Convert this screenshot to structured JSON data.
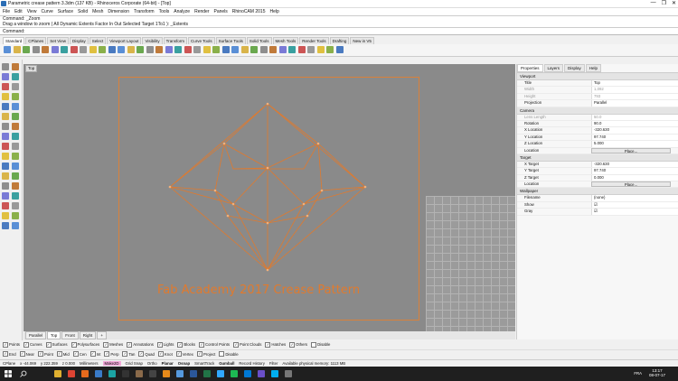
{
  "window": {
    "title": "Parametric crease pattern 3.3dm (137 KB) - Rhinoceros Corporate (64-bit) - [Top]",
    "minimize": "—",
    "maximize": "❐",
    "close": "✕"
  },
  "menu": [
    "File",
    "Edit",
    "View",
    "Curve",
    "Surface",
    "Solid",
    "Mesh",
    "Dimension",
    "Transform",
    "Tools",
    "Analyze",
    "Render",
    "Panels",
    "RhinoCAM 2015",
    "Help"
  ],
  "command_history": [
    "Command: _Zoom",
    "Drag a window to zoom ( All  Dynamic  Extents  Factor  In  Out  Selected  Target  1To1 ): _Extents"
  ],
  "command_prompt": "Command:",
  "toolbar_tabs": [
    "Standard",
    "CPlanes",
    "Set View",
    "Display",
    "Select",
    "Viewport Layout",
    "Visibility",
    "Transform",
    "Curve Tools",
    "Surface Tools",
    "Solid Tools",
    "Mesh Tools",
    "Render Tools",
    "Drafting",
    "New in V5"
  ],
  "viewport": {
    "label": "Top",
    "caption": "Fab Academy 2017 Crease Pattern",
    "tabs": [
      "Parallel",
      "Top",
      "Front",
      "Right"
    ],
    "add_tab": "+"
  },
  "panel": {
    "tabs": [
      "Properties",
      "Layers",
      "Display",
      "Help"
    ],
    "sections": [
      {
        "title": "Viewport",
        "rows": [
          {
            "k": "Title",
            "v": "Top",
            "dim": false
          },
          {
            "k": "Width",
            "v": "1,092",
            "dim": true
          },
          {
            "k": "Height",
            "v": "793",
            "dim": true
          },
          {
            "k": "Projection",
            "v": "Parallel",
            "dim": false
          }
        ]
      },
      {
        "title": "Camera",
        "rows": [
          {
            "k": "Lens Length",
            "v": "50.0",
            "dim": true
          },
          {
            "k": "Rotation",
            "v": "90.0",
            "dim": false
          },
          {
            "k": "X Location",
            "v": "-320.630",
            "dim": false
          },
          {
            "k": "Y Location",
            "v": "97.740",
            "dim": false
          },
          {
            "k": "Z Location",
            "v": "5.000",
            "dim": false
          },
          {
            "k": "Location",
            "v": "Place...",
            "button": true
          }
        ]
      },
      {
        "title": "Target",
        "rows": [
          {
            "k": "X Target",
            "v": "-320.630",
            "dim": false
          },
          {
            "k": "Y Target",
            "v": "97.740",
            "dim": false
          },
          {
            "k": "Z Target",
            "v": "0.000",
            "dim": false
          },
          {
            "k": "Location",
            "v": "Place...",
            "button": true
          }
        ]
      },
      {
        "title": "Wallpaper",
        "rows": [
          {
            "k": "Filename",
            "v": "(none)",
            "dim": false
          },
          {
            "k": "Show",
            "v": "☑",
            "dim": false
          },
          {
            "k": "Gray",
            "v": "☑",
            "dim": false
          }
        ]
      }
    ]
  },
  "filters_row": [
    "Points",
    "Curves",
    "Surfaces",
    "Polysurfaces",
    "Meshes",
    "Annotations",
    "Lights",
    "Blocks",
    "Control Points",
    "Point Clouds",
    "Hatches",
    "Others",
    "Disable"
  ],
  "osnap_row": [
    "End",
    "Near",
    "Point",
    "Mid",
    "Cen",
    "Int",
    "Perp",
    "Tan",
    "Quad",
    "Knot",
    "Vertex",
    "Project",
    "Disable"
  ],
  "status": {
    "cplane": "CPlane",
    "x": "x -44.069",
    "y": "y 222.359",
    "z": "z 0.000",
    "units": "Millimeters",
    "layer": "Make2D",
    "items": [
      "Grid Snap",
      "Ortho",
      "Planar",
      "Osnap",
      "SmartTrack",
      "Gumball",
      "Record History",
      "Filter"
    ],
    "memory": "Available physical memory: 1113 MB"
  },
  "taskbar": {
    "time": "13:17",
    "date": "08-07-17",
    "lang": "FRA"
  },
  "colors": {
    "accent": "#e07a2e",
    "viewport_bg": "#8a8a8a",
    "taskbar": "#1f1f1f"
  }
}
